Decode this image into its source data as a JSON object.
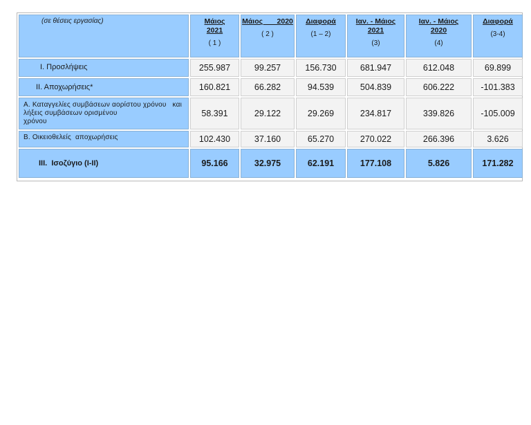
{
  "table": {
    "unit_note": "(σε θέσεις εργασίας)",
    "columns": [
      {
        "title_a": "Μάιος",
        "title_b": "2021",
        "sub": "( 1 )"
      },
      {
        "title_a": "Μάιος       2020",
        "title_b": "",
        "sub": "( 2 )"
      },
      {
        "title_a": "Διαφορά",
        "title_b": "",
        "sub": "(1 – 2)"
      },
      {
        "title_a": "Ιαν. - Μάιος",
        "title_b": "2021",
        "sub": "(3)"
      },
      {
        "title_a": "Ιαν. - Μάιος",
        "title_b": "2020",
        "sub": "(4)"
      },
      {
        "title_a": "Διαφορά",
        "title_b": "",
        "sub": "(3-4)"
      }
    ],
    "rows": [
      {
        "label": "Ι. Προσλήψεις",
        "values": [
          "255.987",
          "99.257",
          "156.730",
          "681.947",
          "612.048",
          "69.899"
        ]
      },
      {
        "label": "ΙΙ. Αποχωρήσεις*",
        "values": [
          "160.821",
          "66.282",
          "94.539",
          "504.839",
          "606.222",
          "-101.383"
        ]
      },
      {
        "label_line1": "Α. Καταγγελίες συμβάσεων αορίστου χρόνου   και",
        "label_line2": "λήξεις συμβάσεων ορισμένου",
        "label_line3": "χρόνου",
        "values": [
          "58.391",
          "29.122",
          "29.269",
          "234.817",
          "339.826",
          "-105.009"
        ]
      },
      {
        "label": "Β. Οικειοθελείς  αποχωρήσεις",
        "values": [
          "102.430",
          "37.160",
          "65.270",
          "270.022",
          "266.396",
          "3.626"
        ]
      },
      {
        "label": "ΙΙΙ.  Ισοζύγιο (Ι-ΙΙ)",
        "values": [
          "95.166",
          "32.975",
          "62.191",
          "177.108",
          "5.826",
          "171.282"
        ]
      }
    ]
  }
}
